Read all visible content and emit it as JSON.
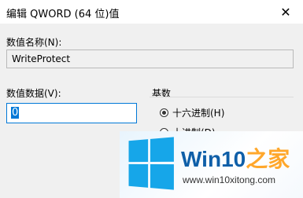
{
  "window": {
    "title": "编辑 QWORD (64 位)值",
    "close_glyph": "✕"
  },
  "value_name": {
    "label": "数值名称(N):",
    "value": "WriteProtect"
  },
  "value_data": {
    "label": "数值数据(V):",
    "value": "0"
  },
  "base": {
    "label": "基数",
    "options": [
      {
        "label": "十六进制(H)",
        "checked": true
      },
      {
        "label": "十进制(D)",
        "checked": false
      }
    ]
  },
  "watermark": {
    "brand_main": "Win10",
    "brand_accent": "之家",
    "site": "www.win10xitong.com",
    "logo_color": "#16a6e9",
    "brand_color": "#0f5fa8",
    "accent_color": "#ffa72b"
  }
}
